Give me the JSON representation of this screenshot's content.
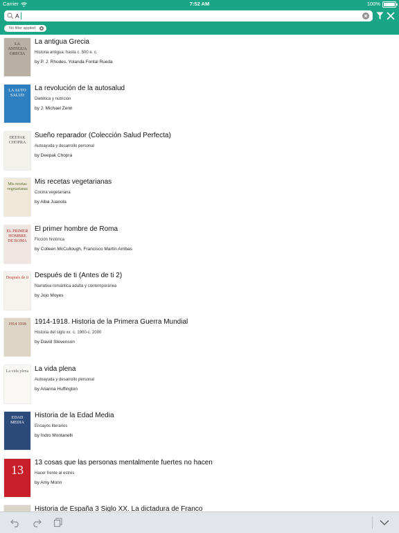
{
  "status_bar": {
    "carrier": "Carrier",
    "time": "7:52 AM",
    "battery": "100%"
  },
  "search": {
    "value": "A",
    "filter_chip": "No filter applied"
  },
  "books": [
    {
      "title": "La antigua Grecia",
      "category": "Historia antigua: hasta c. 500 e. c.",
      "author": "by P. J. Rhodes, Yolanda Fontal Rueda",
      "cover_text": "LA ANTIGUA GRECIA",
      "cover_bg": "#b8b0a2",
      "cover_fg": "#3b342c"
    },
    {
      "title": "La revolución de la autosalud",
      "category": "Dietética y nutrición",
      "author": "by J. Michael Zenn",
      "cover_text": "LA AUTO SALUD",
      "cover_bg": "#2d7fbf",
      "cover_fg": "#ffffff"
    },
    {
      "title": "Sueño reparador (Colección Salud Perfecta)",
      "category": "Autoayuda y desarrollo personal",
      "author": "by Deepak Chopra",
      "cover_text": "DEEPAK CHOPRA",
      "cover_bg": "#f3f1ec",
      "cover_fg": "#555555"
    },
    {
      "title": "Mis recetas vegetarianas",
      "category": "Cocina vegetariana",
      "author": "by Alba Juanola",
      "cover_text": "Mis recetas vegetarianas",
      "cover_bg": "#efe8d8",
      "cover_fg": "#5a6a2a"
    },
    {
      "title": "El primer hombre de Roma",
      "category": "Ficción histórica",
      "author": "by Colleen McCullough, Francisco Martín Arribas",
      "cover_text": "EL PRIMER HOMBRE DE ROMA",
      "cover_bg": "#efe6e2",
      "cover_fg": "#b22c2c"
    },
    {
      "title": "Después de ti (Antes de ti 2)",
      "category": "Narrativa romántica adulta y contemporánea",
      "author": "by Jojo Moyes",
      "cover_text": "Después de ti",
      "cover_bg": "#f6f2ee",
      "cover_fg": "#c2382f"
    },
    {
      "title": "1914-1918. Historia de la Primera Guerra Mundial",
      "category": "Historia del siglo xx: c. 1900-c. 2000",
      "author": "by David Stevenson",
      "cover_text": "1914 1918",
      "cover_bg": "#ddd6c6",
      "cover_fg": "#8a2a20"
    },
    {
      "title": "La vida plena",
      "category": "Autoayuda y desarrollo personal",
      "author": "by Arianna Huffington",
      "cover_text": "La vida plena",
      "cover_bg": "#faf8f4",
      "cover_fg": "#6a6a6a"
    },
    {
      "title": "Historia de la Edad Media",
      "category": "Ensayos literarios",
      "author": "by Indro Montanelli",
      "cover_text": "EDAD MEDIA",
      "cover_bg": "#2c4a7a",
      "cover_fg": "#ffffff"
    },
    {
      "title": "13 cosas que las personas mentalmente fuertes no hacen",
      "category": "Hacer frente al estrés",
      "author": "by Amy Morin",
      "cover_text": "13",
      "cover_bg": "#c81e2a",
      "cover_fg": "#ffffff"
    },
    {
      "title": "Historia de España 3 Siglo XX. La dictadura de Franco",
      "category": "",
      "author": "",
      "cover_text": "",
      "cover_bg": "#d9d4ca",
      "cover_fg": "#333333"
    }
  ],
  "colors": {
    "header": "#1aa586",
    "toolbar": "#e2e5e9"
  },
  "toolbar": {
    "icons": [
      "undo-icon",
      "redo-icon",
      "copy-icon",
      "chevron-down-icon"
    ]
  }
}
